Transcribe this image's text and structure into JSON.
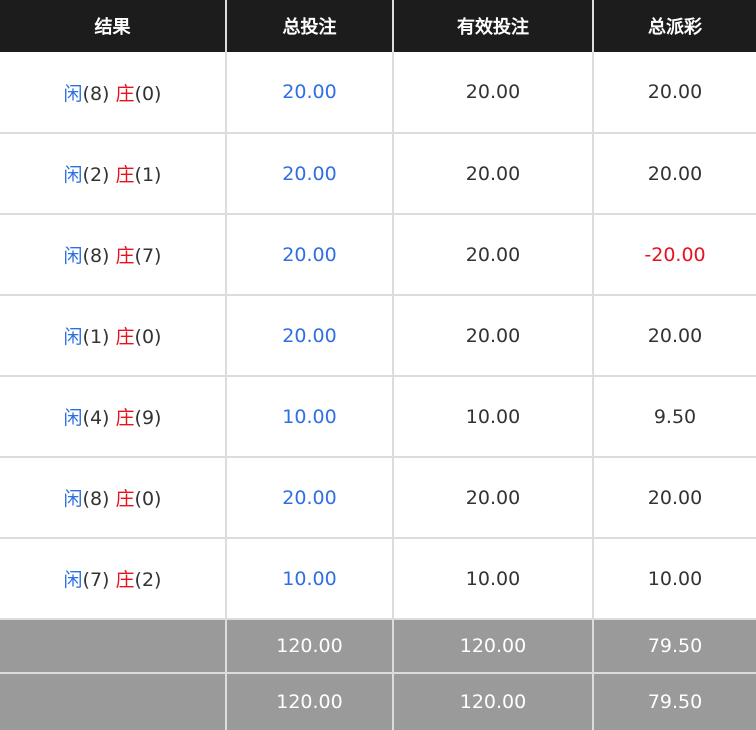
{
  "headers": {
    "result": "结果",
    "total_bet": "总投注",
    "valid_bet": "有效投注",
    "total_payout": "总派彩"
  },
  "labels": {
    "player": "闲",
    "banker": "庄"
  },
  "rows": [
    {
      "player_score": "(8)",
      "banker_score": "(0)",
      "total_bet": "20.00",
      "valid_bet": "20.00",
      "payout": "20.00"
    },
    {
      "player_score": "(2)",
      "banker_score": "(1)",
      "total_bet": "20.00",
      "valid_bet": "20.00",
      "payout": "20.00"
    },
    {
      "player_score": "(8)",
      "banker_score": "(7)",
      "total_bet": "20.00",
      "valid_bet": "20.00",
      "payout": "-20.00"
    },
    {
      "player_score": "(1)",
      "banker_score": "(0)",
      "total_bet": "20.00",
      "valid_bet": "20.00",
      "payout": "20.00"
    },
    {
      "player_score": "(4)",
      "banker_score": "(9)",
      "total_bet": "10.00",
      "valid_bet": "10.00",
      "payout": "9.50"
    },
    {
      "player_score": "(8)",
      "banker_score": "(0)",
      "total_bet": "20.00",
      "valid_bet": "20.00",
      "payout": "20.00"
    },
    {
      "player_score": "(7)",
      "banker_score": "(2)",
      "total_bet": "10.00",
      "valid_bet": "10.00",
      "payout": "10.00"
    }
  ],
  "summary": [
    {
      "total_bet": "120.00",
      "valid_bet": "120.00",
      "payout": "79.50"
    },
    {
      "total_bet": "120.00",
      "valid_bet": "120.00",
      "payout": "79.50"
    }
  ],
  "colors": {
    "player": "#2f6fe4",
    "banker": "#e8121e",
    "header_bg": "#1c1c1c",
    "summary_bg": "#9a9a9a"
  }
}
